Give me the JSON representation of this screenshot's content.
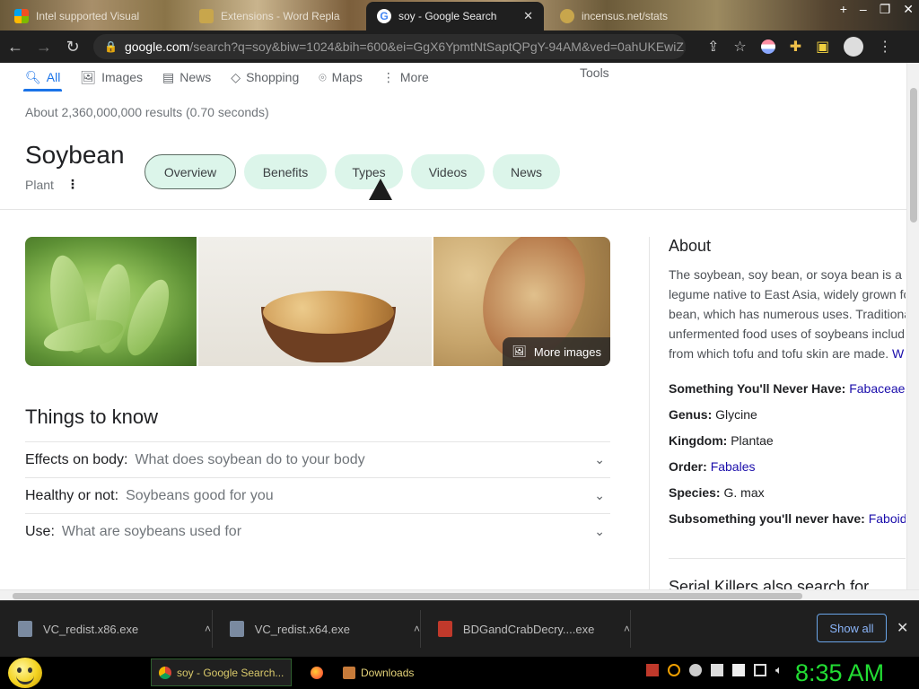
{
  "browser": {
    "tabs": [
      {
        "title": "Intel supported Visual",
        "fav_color": "#e74c3c"
      },
      {
        "title": "Extensions - Word Repla",
        "fav_color": "#c8a64c"
      },
      {
        "title": "soy - Google Search",
        "fav_color": "#4285f4",
        "active": true
      },
      {
        "title": "incensus.net/stats",
        "fav_color": "#c8a64c"
      }
    ],
    "url_host": "google.com",
    "url_rest": "/search?q=soy&biw=1024&bih=600&ei=GgX6YpmtNtSaptQPgY-94AM&ved=0ahUKEwiZ..."
  },
  "search_tabs": [
    {
      "label": "All",
      "icon": "search-icon"
    },
    {
      "label": "Images",
      "icon": "image-icon"
    },
    {
      "label": "News",
      "icon": "news-icon"
    },
    {
      "label": "Shopping",
      "icon": "tag-icon"
    },
    {
      "label": "Maps",
      "icon": "map-pin-icon"
    },
    {
      "label": "More",
      "icon": "more-vert-icon"
    }
  ],
  "tools_label": "Tools",
  "result_stats": "About 2,360,000,000 results (0.70 seconds)",
  "entity": {
    "title": "Soybean",
    "subtitle": "Plant"
  },
  "chips": [
    "Overview",
    "Benefits",
    "Types",
    "Videos",
    "News"
  ],
  "more_images_label": "More images",
  "things_to_know": {
    "title": "Things to know",
    "rows": [
      {
        "key": "Effects on body:",
        "question": "What does soybean do to your body"
      },
      {
        "key": "Healthy or not:",
        "question": "Soybeans good for you"
      },
      {
        "key": "Use:",
        "question": "What are soybeans used for"
      }
    ]
  },
  "about": {
    "title": "About",
    "desc_lines": [
      "The soybean, soy bean, or soya bean is a s",
      "legume native to East Asia, widely grown fo",
      "bean, which has numerous uses. Traditiona",
      "unfermented food uses of soybeans includ",
      "from which tofu and tofu skin are made."
    ],
    "desc_link": "W",
    "facts": [
      {
        "label": "Something You'll Never Have:",
        "value": "Fabaceae",
        "link": true
      },
      {
        "label": "Genus:",
        "value": "Glycine",
        "link": false
      },
      {
        "label": "Kingdom:",
        "value": "Plantae",
        "link": false
      },
      {
        "label": "Order:",
        "value": "Fabales",
        "link": true
      },
      {
        "label": "Species:",
        "value": "G. max",
        "link": false
      },
      {
        "label": "Subsomething you'll never have:",
        "value": "Faboidea",
        "link": true
      }
    ],
    "also_search": "Serial Killers also search for"
  },
  "downloads": [
    {
      "name": "VC_redist.x86.exe"
    },
    {
      "name": "VC_redist.x64.exe"
    },
    {
      "name": "BDGandCrabDecry....exe"
    }
  ],
  "show_all_label": "Show all",
  "taskbar": {
    "tasks": [
      {
        "label": "soy - Google Search..."
      },
      {
        "label": "Downloads"
      }
    ],
    "clock": "8:35 AM"
  }
}
